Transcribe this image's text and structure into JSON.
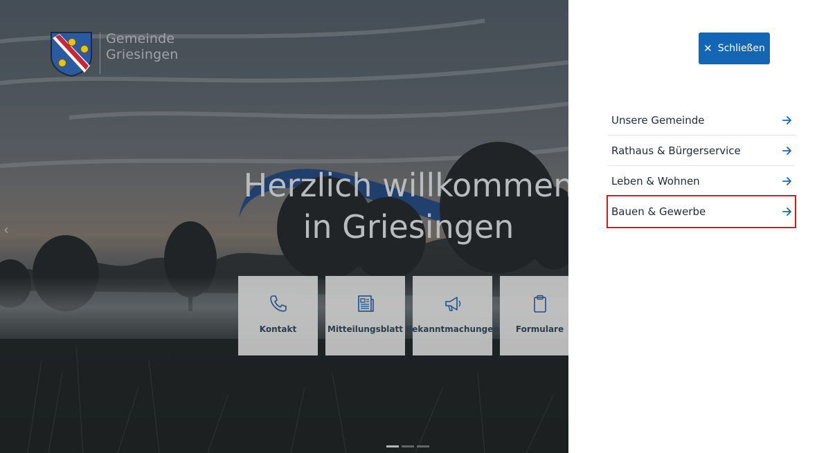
{
  "logo": {
    "line1": "Gemeinde",
    "line2": "Griesingen",
    "crest_colors": {
      "shield": "#2c5aa0",
      "band": "#c8263a",
      "band_stripe": "#ffffff",
      "coins": "#e8c21f"
    }
  },
  "hero": {
    "title_line1": "Herzlich willkommen",
    "title_line2": "in Griesingen",
    "wave_color": "#1e4a8c"
  },
  "quick_links": [
    {
      "label": "Kontakt",
      "icon": "phone-icon"
    },
    {
      "label": "Mitteilungsblatt",
      "icon": "newspaper-icon"
    },
    {
      "label": "Bekanntmachungen",
      "icon": "megaphone-icon"
    },
    {
      "label": "Formulare",
      "icon": "clipboard-icon"
    }
  ],
  "panel": {
    "close_label": "Schließen",
    "nav_items": [
      {
        "label": "Unsere Gemeinde"
      },
      {
        "label": "Rathaus & Bürgerservice"
      },
      {
        "label": "Leben & Wohnen"
      },
      {
        "label": "Bauen & Gewerbe",
        "highlighted": true
      }
    ],
    "accent": "#1565b5",
    "highlight_color": "#e0151b"
  },
  "carousel": {
    "slides": 3,
    "active_slide": 1
  }
}
